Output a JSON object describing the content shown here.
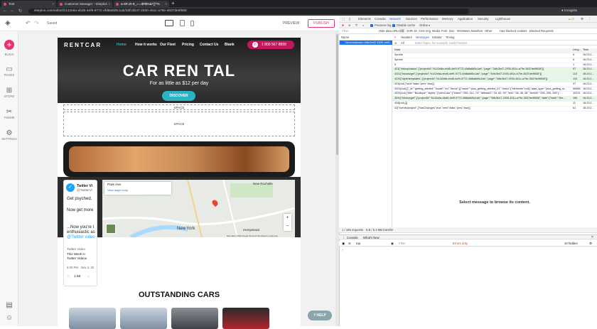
{
  "browser": {
    "tabs": [
      {
        "title": "Test"
      },
      {
        "title": "Customer Manager - Siteplus"
      },
      {
        "title": "a-sR-ZI-9_=-=$#$%&*()^%"
      }
    ],
    "new_tab": "+",
    "url": "siteplus.com/editor/b142e8a-ebd5-4ef9-9772-4fd8a8d5c1ab/3dfc3b47-2930-451c-a79e-3637de9f658"
  },
  "editor": {
    "status": "Saved",
    "preview_label": "PREVIEW",
    "publish_label": "PUBLISH",
    "sidebar": [
      {
        "label": "BUILD"
      },
      {
        "label": "PAGES"
      },
      {
        "label": "STORE"
      },
      {
        "label": "THEME"
      },
      {
        "label": "SETTINGS"
      }
    ],
    "help_label": "HELP"
  },
  "site": {
    "logo": "RENTCAR",
    "nav": [
      "Home",
      "How it works",
      "Our Fleet",
      "Pricing",
      "Contact Us",
      "Blank"
    ],
    "phone": "1 800 567 8899",
    "hero_title": "CAR REN TAL",
    "hero_subtitle": "For as little as $12 per day",
    "cta": "DISCOVER",
    "space_label": "SPACE",
    "twitter": {
      "name": "Twitter Vi",
      "handle": "@TwitterVi",
      "lines": [
        "Get psyched.",
        "Now get more",
        "...Now you're t",
        "enthusiastic as",
        "@Twitter video"
      ],
      "card_title": "Twitter Video",
      "card_lines": [
        "This Week in",
        "Twitter Videos"
      ],
      "time": "6:00 PM · Nov 4, 20",
      "likes": "1.5K"
    },
    "map": {
      "place": "Park Ave",
      "link": "View larger map",
      "labels": [
        "New Rochelle",
        "New York",
        "Hempstead"
      ],
      "footer": "Map data ©2022 Google   Terms of Use   Report a map error"
    },
    "section_title": "OUTSTANDING CARS"
  },
  "devtools": {
    "tabs": [
      "Elements",
      "Console",
      "Network",
      "Sources",
      "Performance",
      "Memory",
      "Application",
      "Security",
      "Lighthouse"
    ],
    "active_tab": "Network",
    "toolbar": {
      "preserve_log": "Preserve log",
      "disable_cache": "Disable cache",
      "throttle": "Online"
    },
    "filter_placeholder": "Filter",
    "filter_types": [
      "Hide data URLs",
      "All",
      "XHR",
      "JS",
      "CSS",
      "Img",
      "Media",
      "Font",
      "Doc",
      "WS",
      "Wasm",
      "Manifest",
      "Other",
      "Has blocked cookies",
      "Blocked Requests"
    ],
    "name_header": "Name",
    "selected_request": "?access&auto=4dfc2e82-4839-4ef3...",
    "subtabs": [
      "Headers",
      "Messages",
      "Initiator",
      "Timing"
    ],
    "msg_filter_all": "All",
    "msg_filter_placeholder": "Enter regex, for example: (web)?socket",
    "msg_headers": {
      "data": "Data",
      "length": "Leng...",
      "time": "Time"
    },
    "messages": [
      {
        "data": "2probe",
        "len": "6",
        "time": "16:23:1...",
        "green": false
      },
      {
        "data": "3probe",
        "len": "6",
        "time": "16:23:1...",
        "green": false
      },
      {
        "data": "5",
        "len": "1",
        "time": "16:23:1...",
        "green": false
      },
      {
        "data": "421[\"history/status\",{\"projectId\":\"b142e8a-ebd5-4ef9-9772-4fd8a8d5c1ab\",\"page\":\"3dfc3b47-2930-451c-a79e-3637de9f658\"}]",
        "len": "97",
        "time": "16:23:1...",
        "green": true
      },
      {
        "data": "4221[\"blocks/get\",{\"projectId\":\"b142e8a-ebd5-4ef9-9772-4fd8a8d5c1ab\",\"page\":\"3dfc3b47-2930-451c-a79e-3637de9f658\"}]",
        "len": "110",
        "time": "16:23:1...",
        "green": true
      },
      {
        "data": "4231[\"style/templates\",{\"projectId\":\"b142e8a-ebd5-4ef9-9772-4fd8a8d5c1ab\",\"page\":\"3dfc3b47-2930-451c-a79e-3637de9f658\"}]",
        "len": "115",
        "time": "16:23:1...",
        "green": true
      },
      {
        "data": "431[null,{\"next\":false,\"prev\":true}]",
        "len": "37",
        "time": "16:23:1...",
        "green": false
      },
      {
        "data": "4321[null,[{\"_id\":\"getting_started\",\"locale\":\"en\",\"items\":[{\"name\":\"plus_getting_started_01\",\"meta\":{\"elements\":null},\"data_type\":\"plus_getting_st...",
        "len": "50666",
        "time": "16:23:1...",
        "green": false
      },
      {
        "data": "4331[null,{\"title\":\"Boutique\",\"styles\":{\"primColor\":{\"brand\":\"255, 110, 73\",\"altbase2\":\"33, 60, 90\",\"text\":\"38, 38, 38\",\"textAlt\":\"255, 255, 255\"},\"...",
        "len": "10221",
        "time": "16:23:1...",
        "green": false
      },
      {
        "data": "4241[\"history/get\",{\"projectId\":\"b142e8a-ebd5-4ef9-9772-4fd8a8d5c1ab\",\"page\":\"3dfc3b47-2930-451c-a79e-3637de9f658\",\"date\":{\"hash\":\"blo...",
        "len": "184",
        "time": "16:23:1...",
        "green": true
      },
      {
        "data": "434[null,{}]",
        "len": "11",
        "time": "16:23:1...",
        "green": false
      },
      {
        "data": "42[\"events/project\",{\"hasChanges\":true,\"next\":false,\"prev\":true}]",
        "len": "61",
        "time": "16:23:1...",
        "green": false
      }
    ],
    "empty_message": "Select message to browse its content.",
    "summary": "1 / 185 requests",
    "transfer": "5 B / 5.3 MB transfer",
    "console_tabs": [
      "Console",
      "What's New"
    ],
    "console_context": "top",
    "console_filter": "Filter",
    "console_level": "Errors only",
    "hidden_count": "10 hidden"
  },
  "colors": {
    "accent": "#e8336d",
    "cta": "#2ab3c6",
    "devtools_blue": "#1a73e8",
    "green_row": "#e4f7e2"
  }
}
